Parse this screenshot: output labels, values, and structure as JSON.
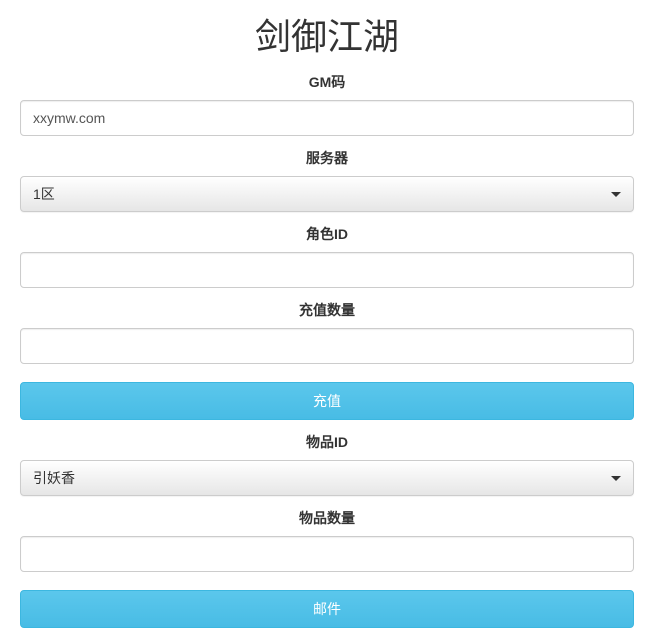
{
  "title": "剑御江湖",
  "fields": {
    "gm": {
      "label": "GM码",
      "value": "xxymw.com"
    },
    "server": {
      "label": "服务器",
      "selected": "1区"
    },
    "roleId": {
      "label": "角色ID",
      "value": ""
    },
    "rechargeQty": {
      "label": "充值数量",
      "value": ""
    },
    "itemId": {
      "label": "物品ID",
      "selected": "引妖香"
    },
    "itemQty": {
      "label": "物品数量",
      "value": ""
    }
  },
  "buttons": {
    "recharge": "充值",
    "mail": "邮件"
  }
}
